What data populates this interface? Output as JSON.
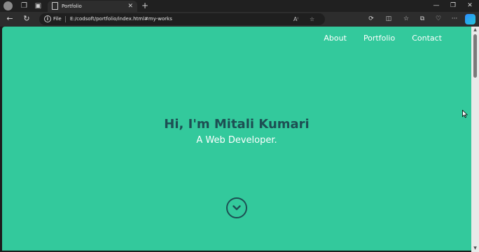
{
  "browser": {
    "tab_title": "Portfolio",
    "file_label": "File",
    "url": "E:/codsoft/portfolio/index.html#my-works",
    "read_aloud_label": "Aⁱ"
  },
  "site": {
    "nav": [
      "About",
      "Portfolio",
      "Contact"
    ],
    "hero_title": "Hi, I'm Mitali Kumari",
    "hero_subtitle": "A Web Developer."
  },
  "colors": {
    "page_background": "#33c99c",
    "hero_title": "#1d4f53",
    "hero_subtitle": "#ffffff"
  },
  "icons": {
    "scroll_button": "chevron-down-circle"
  }
}
